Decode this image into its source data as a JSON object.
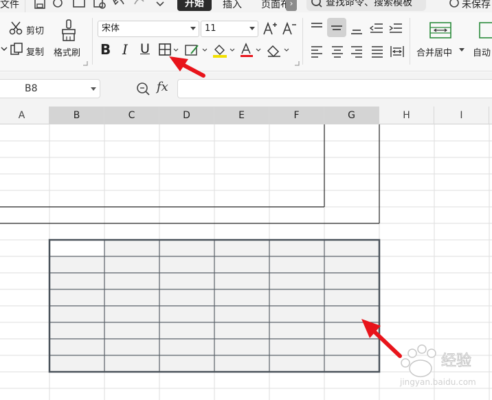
{
  "menu": {
    "file": "文件",
    "tab_home": "开始",
    "tab_insert": "插入",
    "tab_page": "页面布",
    "search": "查找命令、搜索模板",
    "save_status": "未保存"
  },
  "ribbon": {
    "cut": "剪切",
    "copy": "复制",
    "format_painter": "格式刷",
    "font_name": "宋体",
    "font_size": "11",
    "bold": "B",
    "italic": "I",
    "underline": "U",
    "merge_center": "合并居中",
    "auto_wrap": "自动"
  },
  "formula_bar": {
    "cell_ref": "B8",
    "fx": "fx"
  },
  "columns": [
    "A",
    "B",
    "C",
    "D",
    "E",
    "F",
    "G",
    "H",
    "I"
  ],
  "selected_columns": [
    "B",
    "C",
    "D",
    "E",
    "F",
    "G"
  ],
  "colors": {
    "annotation_arrow": "#e8141b",
    "selection_fill": "#f2f2f2",
    "selection_border": "#4a525a"
  },
  "watermark": "Baidu 经验 jingyan.baidu.com"
}
